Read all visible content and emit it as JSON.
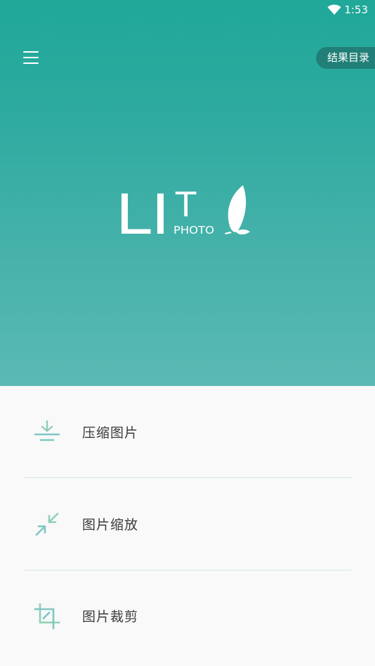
{
  "status_bar": {
    "time": "1:53"
  },
  "header": {
    "menu_icon": "menu-icon",
    "result_button_label": "结果目录"
  },
  "logo": {
    "letters": "LI",
    "t_letter": "T",
    "sub_text": "PHOTO",
    "leaf_icon": "leaf-icon"
  },
  "menu": {
    "items": [
      {
        "label": "压缩图片",
        "icon": "compress-icon"
      },
      {
        "label": "图片缩放",
        "icon": "resize-icon"
      },
      {
        "label": "图片裁剪",
        "icon": "crop-icon"
      }
    ]
  },
  "colors": {
    "hero_top": "#20a899",
    "hero_bottom": "#5bb9b4",
    "result_button_bg": "#217f77",
    "icon_green": "#8fcfb4",
    "icon_teal": "#7ec7c2",
    "background": "#f9f9f9"
  }
}
